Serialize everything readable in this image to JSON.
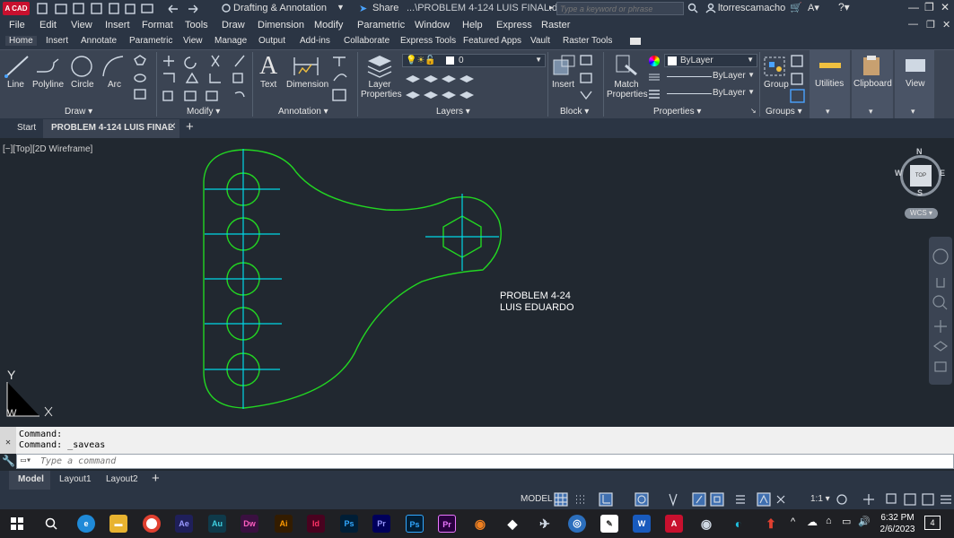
{
  "title_bar": {
    "app_badge": "A CAD",
    "workspace": "Drafting & Annotation",
    "share": "Share",
    "file_path": "...\\PROBLEM 4-124 LUIS FINAL.dwg",
    "search_placeholder": "Type a keyword or phrase",
    "user": "ltorrescamacho"
  },
  "menu": [
    "File",
    "Edit",
    "View",
    "Insert",
    "Format",
    "Tools",
    "Draw",
    "Dimension",
    "Modify",
    "Parametric",
    "Window",
    "Help",
    "Express",
    "Raster"
  ],
  "ribbon_tabs": [
    "Home",
    "Insert",
    "Annotate",
    "Parametric",
    "View",
    "Manage",
    "Output",
    "Add-ins",
    "Collaborate",
    "Express Tools",
    "Featured Apps",
    "Vault",
    "Raster Tools"
  ],
  "ribbon": {
    "draw": {
      "line": "Line",
      "polyline": "Polyline",
      "circle": "Circle",
      "arc": "Arc",
      "panel": "Draw"
    },
    "modify": {
      "panel": "Modify"
    },
    "annotation": {
      "text": "Text",
      "dimension": "Dimension",
      "panel": "Annotation"
    },
    "layers": {
      "layer_properties": "Layer Properties",
      "current_layer": "0",
      "panel": "Layers"
    },
    "block": {
      "insert": "Insert",
      "panel": "Block"
    },
    "properties": {
      "match": "Match Properties",
      "color": "ByLayer",
      "linetype": "ByLayer",
      "lineweight": "ByLayer",
      "panel": "Properties"
    },
    "groups": {
      "group": "Group",
      "panel": "Groups"
    },
    "utilities": "Utilities",
    "clipboard": "Clipboard",
    "view": "View"
  },
  "doc_tabs": {
    "start": "Start",
    "active": "PROBLEM 4-124 LUIS FINAL"
  },
  "viewport": {
    "label": "[−][Top][2D Wireframe]",
    "drawing_text_1": "PROBLEM   4-24",
    "drawing_text_2": "LUIS EDUARDO",
    "ucs_x": "X",
    "ucs_y": "Y",
    "ucs_w": "W",
    "viewcube": {
      "n": "N",
      "s": "S",
      "e": "E",
      "w": "W",
      "face": "TOP",
      "wcs": "WCS"
    }
  },
  "command": {
    "line1": "Command:",
    "line2": "Command: _saveas",
    "placeholder": "Type a command"
  },
  "layout_tabs": [
    "Model",
    "Layout1",
    "Layout2"
  ],
  "status": {
    "model": "MODEL",
    "scale": "1:1"
  },
  "taskbar": {
    "time": "6:32 PM",
    "date": "2/6/2023",
    "apps": [
      "Ae",
      "Au",
      "Dw",
      "Ai",
      "Id",
      "Ps",
      "Pr",
      "Ps",
      "Pr"
    ],
    "notification_count": "4"
  },
  "colors": {
    "drawing": "#22d622",
    "center": "#00d7e6",
    "ui_dark": "#2b3544",
    "ribbon": "#3b4453"
  }
}
